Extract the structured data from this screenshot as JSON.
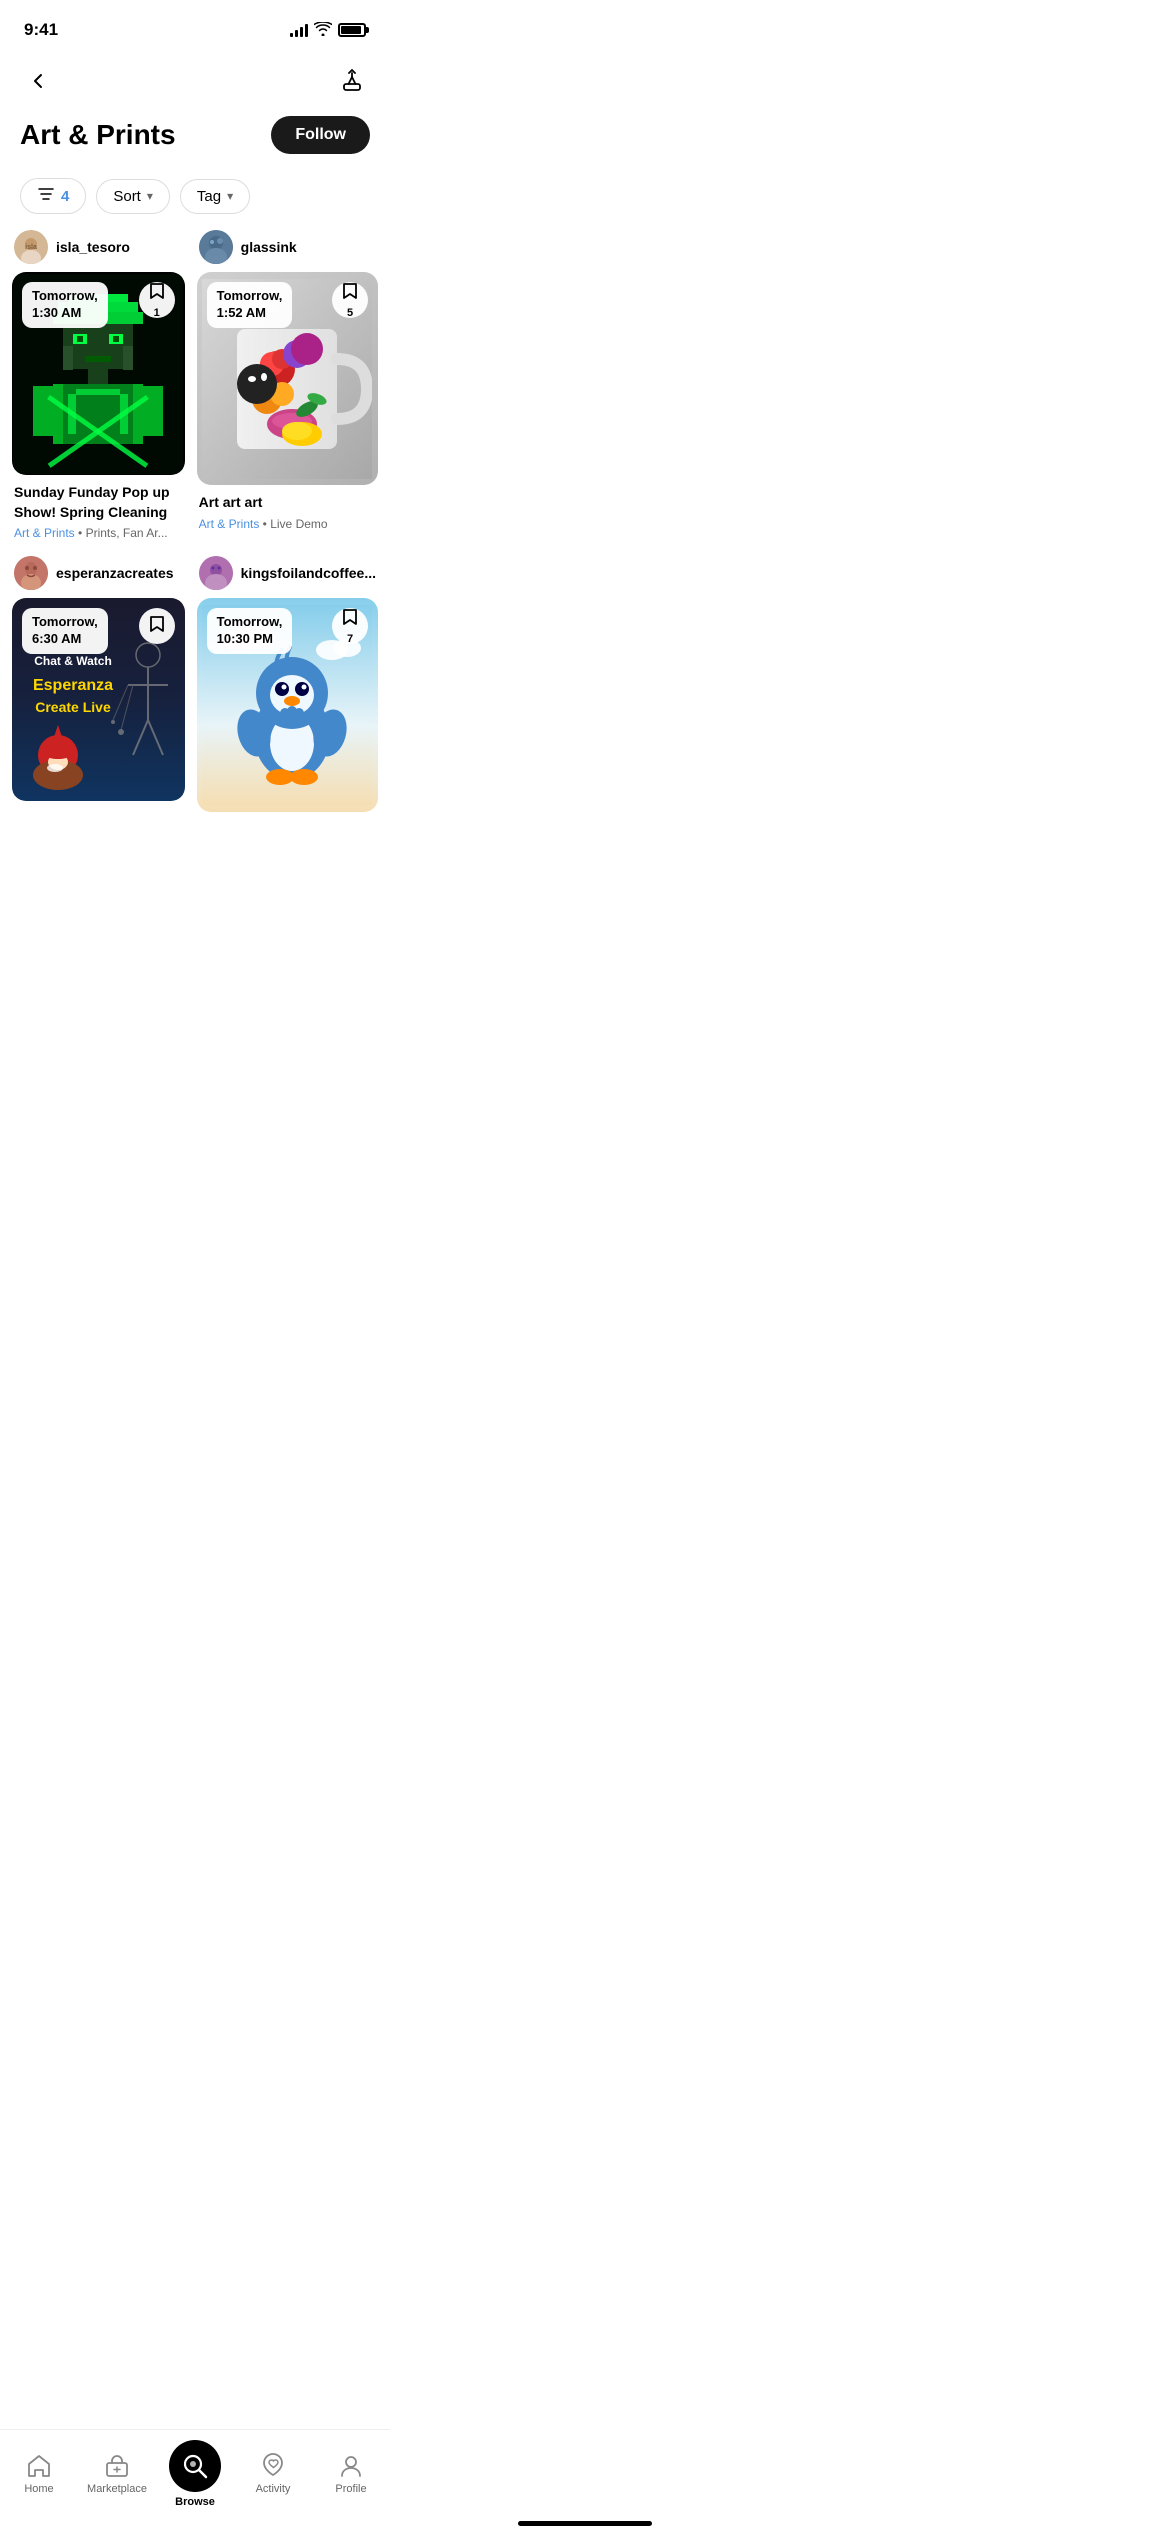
{
  "statusBar": {
    "time": "9:41",
    "signal": 4,
    "wifi": true,
    "battery": 90
  },
  "nav": {
    "backLabel": "‹",
    "shareLabel": "share"
  },
  "header": {
    "title": "Art & Prints",
    "followLabel": "Follow"
  },
  "filters": {
    "filterIcon": "⊞",
    "filterCount": "4",
    "sortLabel": "Sort",
    "tagLabel": "Tag"
  },
  "cards": [
    {
      "id": "card-1",
      "username": "isla_tesoro",
      "time": "Tomorrow,\n1:30 AM",
      "bookmarkCount": "1",
      "title": "Sunday Funday Pop up Show! Spring Cleaning",
      "tagPrimary": "Art & Prints",
      "tagSecondary": "Prints, Fan Ar...",
      "type": "anime"
    },
    {
      "id": "card-2",
      "username": "glassink",
      "time": "Tomorrow,\n1:52 AM",
      "bookmarkCount": "5",
      "title": "Art art art",
      "tagPrimary": "Art & Prints",
      "tagSecondary": "Live Demo",
      "type": "mug"
    },
    {
      "id": "card-3",
      "username": "esperanzacreates",
      "time": "Tomorrow,\n6:30 AM",
      "bookmarkCount": "",
      "title": "Chat & Watch Esperanza Create Live",
      "tagPrimary": "",
      "tagSecondary": "",
      "type": "esperanza"
    },
    {
      "id": "card-4",
      "username": "kingsfoilandcoffee...",
      "time": "Tomorrow,\n10:30 PM",
      "bookmarkCount": "7",
      "title": "",
      "tagPrimary": "",
      "tagSecondary": "",
      "type": "piplup"
    }
  ],
  "bottomNav": {
    "items": [
      {
        "id": "home",
        "label": "Home",
        "active": false
      },
      {
        "id": "marketplace",
        "label": "Marketplace",
        "active": false
      },
      {
        "id": "browse",
        "label": "Browse",
        "active": true
      },
      {
        "id": "activity",
        "label": "Activity",
        "active": false
      },
      {
        "id": "profile",
        "label": "Profile",
        "active": false
      }
    ]
  }
}
